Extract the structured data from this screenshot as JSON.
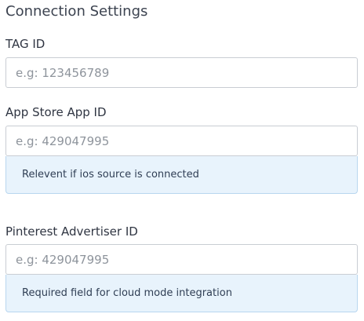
{
  "section": {
    "title": "Connection Settings"
  },
  "fields": {
    "tag_id": {
      "label": "TAG ID",
      "placeholder": "e.g: 123456789",
      "value": ""
    },
    "app_store_app_id": {
      "label": "App Store App ID",
      "placeholder": "e.g: 429047995",
      "value": "",
      "help_text": "Relevent if ios source is connected"
    },
    "pinterest_advertiser_id": {
      "label": "Pinterest Advertiser ID",
      "placeholder": "e.g: 429047995",
      "value": "",
      "help_text": "Required field for cloud mode integration"
    }
  },
  "colors": {
    "info_background": "#e8f3fc",
    "info_border": "#b8d6ef",
    "input_border": "#c9cdd3"
  }
}
